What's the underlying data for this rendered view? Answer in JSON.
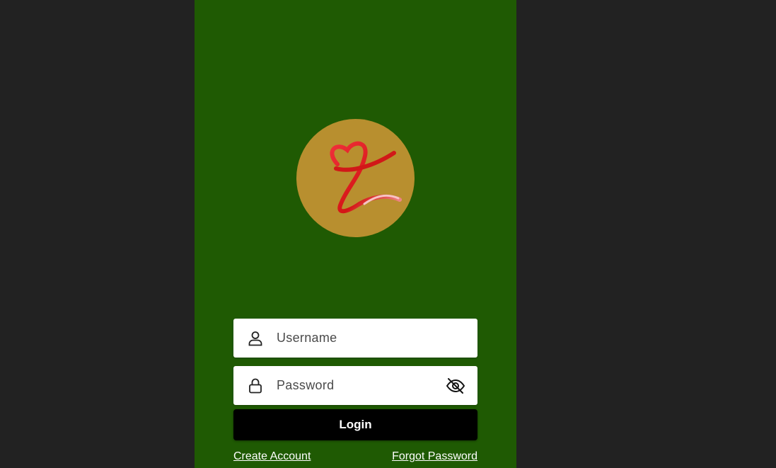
{
  "colors": {
    "background": "#222222",
    "app_background": "#1f5a03",
    "logo_circle": "#b88f2f",
    "logo_ribbon": "#e21b1b",
    "button_background": "#000000",
    "button_text": "#ffffff"
  },
  "logo": {
    "icon": "heart-ribbon-logo"
  },
  "username": {
    "placeholder": "Username",
    "value": "",
    "icon": "user-icon"
  },
  "password": {
    "placeholder": "Password",
    "value": "",
    "icon": "lock-icon",
    "toggle_icon": "eye-off-icon"
  },
  "login": {
    "label": "Login"
  },
  "links": {
    "create_account": "Create Account",
    "forgot_password": "Forgot Password"
  }
}
